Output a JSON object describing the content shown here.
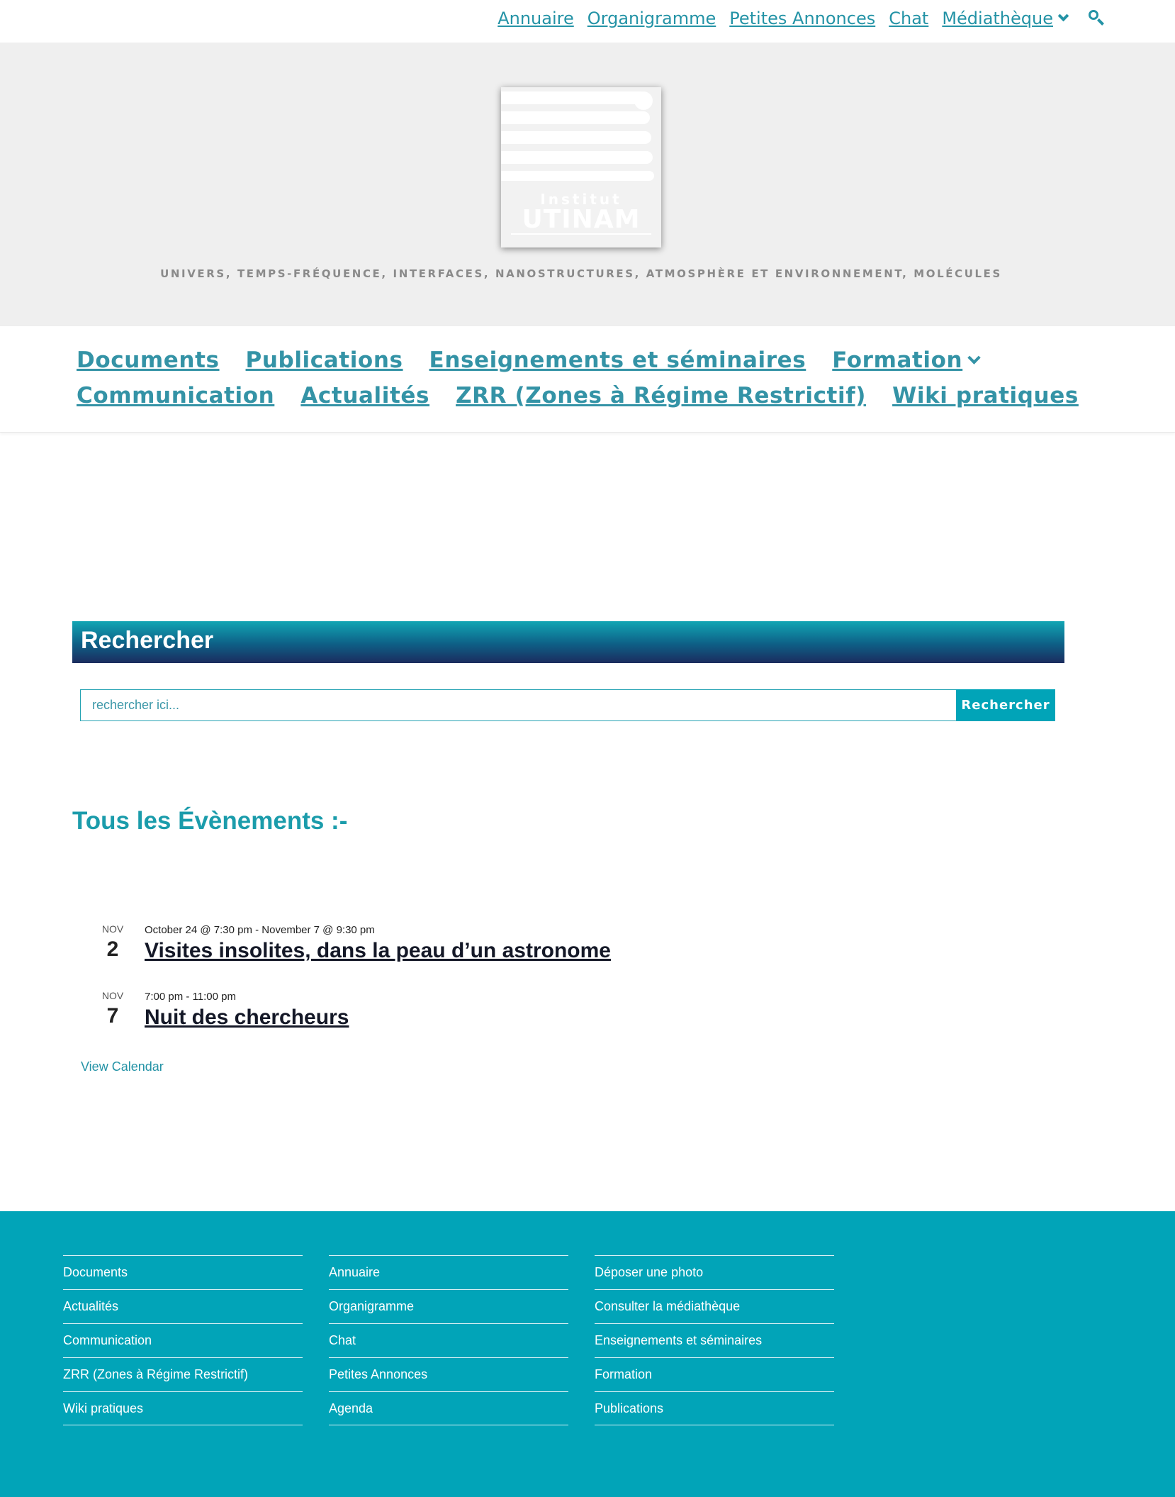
{
  "top_nav": {
    "items": [
      "Annuaire",
      "Organigramme",
      "Petites Annonces",
      "Chat",
      "Médiathèque"
    ],
    "search_icon": "search-icon"
  },
  "header": {
    "logo": {
      "line1": "Institut",
      "line2": "UTINAM"
    },
    "tagline": "UNIVERS, TEMPS-FRÉQUENCE, INTERFACES, NANOSTRUCTURES, ATMOSPHÈRE ET ENVIRONNEMENT, MOLÉCULES"
  },
  "main_nav": {
    "items": [
      "Documents",
      "Publications",
      "Enseignements et séminaires",
      "Formation",
      "Communication",
      "Actualités",
      "ZRR (Zones à Régime Restrictif)",
      "Wiki pratiques"
    ]
  },
  "search_widget": {
    "title": "Rechercher",
    "placeholder": "rechercher ici...",
    "button": "Rechercher"
  },
  "events": {
    "heading": "Tous les Évènements :-",
    "list": [
      {
        "month": "NOV",
        "day": "2",
        "time": "October 24 @ 7:30 pm - November 7 @ 9:30 pm",
        "title": "Visites insolites, dans la peau d’un astronome"
      },
      {
        "month": "NOV",
        "day": "7",
        "time": "7:00 pm - 11:00 pm",
        "title": "Nuit des chercheurs"
      }
    ],
    "view_calendar": "View Calendar"
  },
  "footer": {
    "columns": [
      [
        "Documents",
        "Actualités",
        "Communication",
        "ZRR (Zones à Régime Restrictif)",
        "Wiki pratiques"
      ],
      [
        "Annuaire",
        "Organigramme",
        "Chat",
        "Petites Annonces",
        "Agenda"
      ],
      [
        "Déposer une photo",
        "Consulter la médiathèque",
        "Enseignements et séminaires",
        "Formation",
        "Publications"
      ]
    ]
  },
  "colors": {
    "accent": "#2493a6",
    "header_bg": "#efefef",
    "footer_bg": "#01a4b8",
    "widget_gradient_top": "#11a5b4",
    "widget_gradient_bottom": "#1b2c5e"
  }
}
